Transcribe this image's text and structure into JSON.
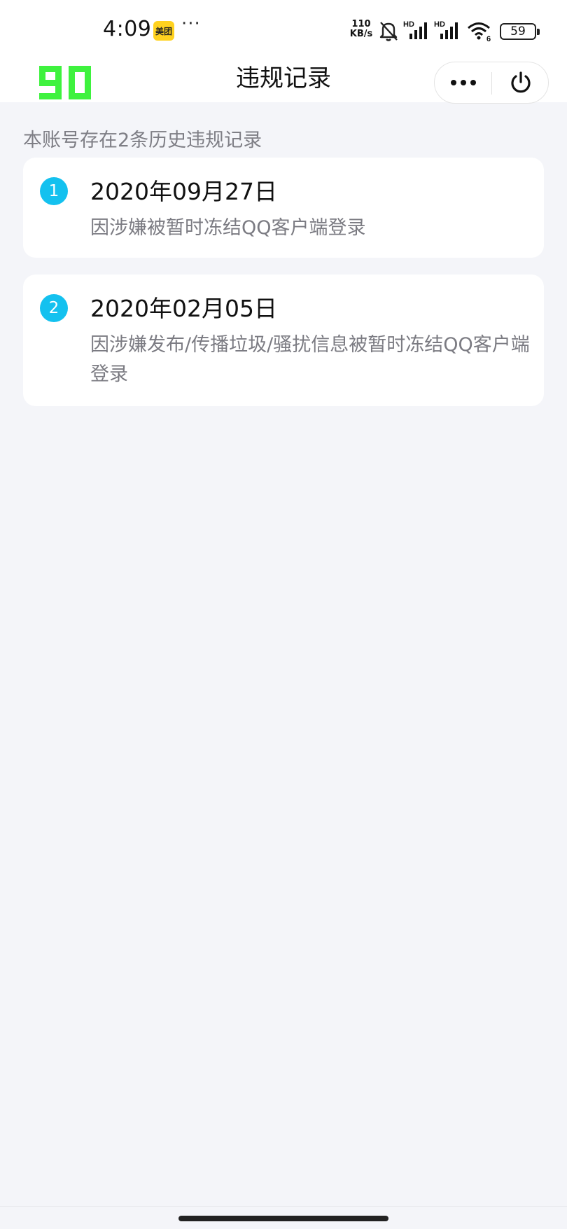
{
  "status_bar": {
    "time": "4:09",
    "app_badge": "美团",
    "more": "···",
    "net_speed_value": "110",
    "net_speed_unit": "KB/s",
    "signal_label": "HD",
    "wifi_label": "6",
    "battery": "59",
    "icons": [
      "meituan-app-icon",
      "bell-off-icon",
      "signal-hd-icon",
      "signal-hd-icon",
      "wifi-6-icon",
      "battery-icon"
    ]
  },
  "nav": {
    "logo_text": "90",
    "title": "违规记录",
    "icons": [
      "more-dots-icon",
      "power-icon"
    ]
  },
  "summary": "本账号存在2条历史违规记录",
  "records": [
    {
      "index": "1",
      "date": "2020年09月27日",
      "description": "因涉嫌被暂时冻结QQ客户端登录"
    },
    {
      "index": "2",
      "date": "2020年02月05日",
      "description": "因涉嫌发布/传播垃圾/骚扰信息被暂时冻结QQ客户端登录"
    }
  ],
  "colors": {
    "page_background": "#f4f5f9",
    "card_background": "#ffffff",
    "badge": "#14c1ef",
    "logo": "#3ef23e",
    "secondary_text": "#7b7b82"
  }
}
